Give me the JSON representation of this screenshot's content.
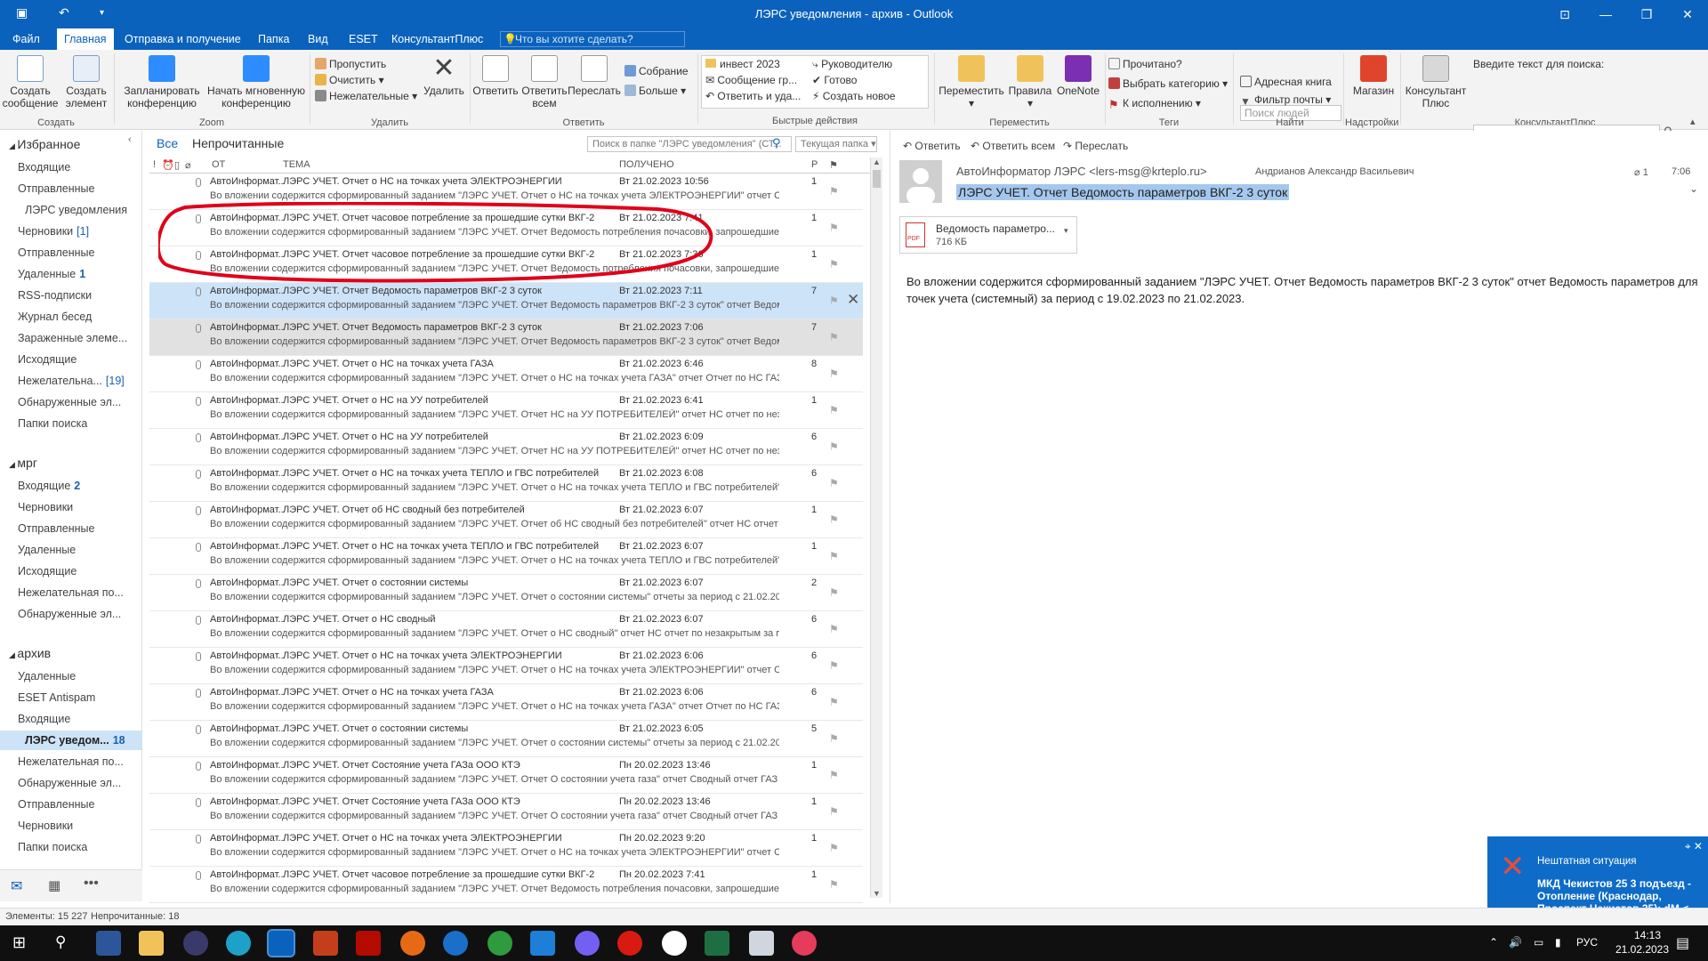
{
  "window": {
    "title": "ЛЭРС уведомления - архив - Outlook"
  },
  "menu": {
    "tabs": [
      "Файл",
      "Главная",
      "Отправка и получение",
      "Папка",
      "Вид",
      "ESET",
      "КонсультантПлюс"
    ],
    "tellme": "Что вы хотите сделать?"
  },
  "ribbon": {
    "create": {
      "label": "Создать",
      "new_mail": "Создать\nсообщение",
      "new_item": "Создать\nэлемент"
    },
    "zoom": {
      "label": "Zoom",
      "schedule": "Запланировать\nконференцию",
      "instant": "Начать мгновенную\nконференцию"
    },
    "delete": {
      "label": "Удалить",
      "ignore": "Пропустить",
      "clean": "Очистить",
      "junk": "Нежелательные",
      "delete_btn": "Удалить"
    },
    "respond": {
      "label": "Ответить",
      "reply": "Ответить",
      "reply_all": "Ответить\nвсем",
      "forward": "Переслать",
      "meeting": "Собрание",
      "more": "Больше"
    },
    "quick": {
      "label": "Быстрые действия",
      "items": [
        "инвест 2023",
        "Руководителю",
        "Сообщение гр...",
        "Готово",
        "Ответить и уда...",
        "Создать новое"
      ]
    },
    "move": {
      "label": "Переместить",
      "move_btn": "Переместить",
      "rules": "Правила",
      "onenote": "OneNote"
    },
    "tags": {
      "label": "Теги",
      "read": "Прочитано?",
      "category": "Выбрать категорию",
      "followup": "К исполнению"
    },
    "find": {
      "label": "Найти",
      "search_people": "Поиск людей",
      "address_book": "Адресная книга",
      "filter": "Фильтр почты"
    },
    "addins": {
      "label": "Надстройки",
      "store": "Магазин"
    },
    "consultant": {
      "label": "КонсультантПлюс",
      "btn": "Консультант\nПлюс",
      "prompt": "Введите текст для поиска:"
    }
  },
  "nav": [
    {
      "label": "Избранное",
      "type": "hdr"
    },
    {
      "label": "Входящие"
    },
    {
      "label": "Отправленные"
    },
    {
      "label": "ЛЭРС уведомления",
      "indent": true
    },
    {
      "label": "Черновики",
      "count": "[1]"
    },
    {
      "label": "Отправленные"
    },
    {
      "label": "Удаленные",
      "count": "1",
      "bold": true
    },
    {
      "label": "RSS-подписки"
    },
    {
      "label": "Журнал бесед"
    },
    {
      "label": "Зараженные элеме..."
    },
    {
      "label": "Исходящие"
    },
    {
      "label": "Нежелательна...",
      "count": "[19]"
    },
    {
      "label": "Обнаруженные эл..."
    },
    {
      "label": "Папки поиска"
    },
    {
      "label": "",
      "type": "gap"
    },
    {
      "label": "мрг",
      "type": "hdr"
    },
    {
      "label": "Входящие",
      "count": "2",
      "bold": true
    },
    {
      "label": "Черновики"
    },
    {
      "label": "Отправленные"
    },
    {
      "label": "Удаленные"
    },
    {
      "label": "Исходящие"
    },
    {
      "label": "Нежелательная по..."
    },
    {
      "label": "Обнаруженные эл..."
    },
    {
      "label": "",
      "type": "gap"
    },
    {
      "label": "архив",
      "type": "hdr"
    },
    {
      "label": "Удаленные"
    },
    {
      "label": "ESET Antispam"
    },
    {
      "label": "Входящие"
    },
    {
      "label": "ЛЭРС уведом...",
      "count": "18",
      "bold": true,
      "sel": true,
      "indent": true
    },
    {
      "label": "Нежелательная по..."
    },
    {
      "label": "Обнаруженные эл..."
    },
    {
      "label": "Отправленные"
    },
    {
      "label": "Черновики"
    },
    {
      "label": "Папки поиска"
    }
  ],
  "list": {
    "filter_all": "Все",
    "filter_unread": "Непрочитанные",
    "search_placeholder": "Поиск в папке \"ЛЭРС уведомления\" (СТ...",
    "current_folder": "Текущая папка",
    "col_from": "ОТ",
    "col_subject": "ТЕМА",
    "col_received": "ПОЛУЧЕНО",
    "col_size": "Р",
    "rows": [
      {
        "from": "АвтоИнформат...",
        "subject": "ЛЭРС УЧЕТ. Отчет о НС на точках учета ЭЛЕКТРОЭНЕРГИИ",
        "date": "Вт 21.02.2023 10:56",
        "size": "1",
        "preview": "Во вложении содержится сформированный заданием \"ЛЭРС УЧЕТ. Отчет о НС на точках учета ЭЛЕКТРОЭНЕРГИИ\" отчет Отчет по"
      },
      {
        "from": "АвтоИнформат...",
        "subject": "ЛЭРС УЧЕТ. Отчет часовое потребление за прошедшие сутки ВКГ-2",
        "date": "Вт 21.02.2023 7:41",
        "size": "1",
        "preview": "Во вложении содержится сформированный заданием \"ЛЭРС УЧЕТ. Отчет Ведомость потребления почасовки, запрошедшие сутки\""
      },
      {
        "from": "АвтоИнформат...",
        "subject": "ЛЭРС УЧЕТ. Отчет часовое потребление за прошедшие сутки ВКГ-2",
        "date": "Вт 21.02.2023 7:36",
        "size": "1",
        "preview": "Во вложении содержится сформированный заданием \"ЛЭРС УЧЕТ. Отчет Ведомость потребления почасовки, запрошедшие сутки\""
      },
      {
        "from": "АвтоИнформат...",
        "subject": "ЛЭРС УЧЕТ. Отчет Ведомость параметров ВКГ-2 3 суток",
        "date": "Вт 21.02.2023 7:11",
        "size": "7",
        "preview": "Во вложении содержится сформированный заданием \"ЛЭРС УЧЕТ. Отчет Ведомость параметров ВКГ-2 3 суток\" отчет Ведомость",
        "state": "sel"
      },
      {
        "from": "АвтоИнформат...",
        "subject": "ЛЭРС УЧЕТ. Отчет Ведомость параметров ВКГ-2 3 суток",
        "date": "Вт 21.02.2023 7:06",
        "size": "7",
        "preview": "Во вложении содержится сформированный заданием \"ЛЭРС УЧЕТ. Отчет Ведомость параметров ВКГ-2 3 суток\" отчет Ведомость",
        "state": "hl"
      },
      {
        "from": "АвтоИнформат...",
        "subject": "ЛЭРС УЧЕТ. Отчет о НС на точках учета ГАЗА",
        "date": "Вт 21.02.2023 6:46",
        "size": "8",
        "preview": "Во вложении содержится сформированный заданием \"ЛЭРС УЧЕТ. Отчет о НС на точках учета ГАЗА\" отчет Отчет по НС ГАЗ за"
      },
      {
        "from": "АвтоИнформат...",
        "subject": "ЛЭРС УЧЕТ. Отчет о НС на УУ потребителей",
        "date": "Вт 21.02.2023 6:41",
        "size": "1",
        "preview": "Во вложении содержится сформированный заданием \"ЛЭРС УЧЕТ. Отчет НС на УУ ПОТРЕБИТЕЛЕЙ\" отчет НС отчет по незакрытым"
      },
      {
        "from": "АвтоИнформат...",
        "subject": "ЛЭРС УЧЕТ. Отчет о НС на УУ потребителей",
        "date": "Вт 21.02.2023 6:09",
        "size": "6",
        "preview": "Во вложении содержится сформированный заданием \"ЛЭРС УЧЕТ. Отчет НС на УУ ПОТРЕБИТЕЛЕЙ\" отчет НС отчет по незакрытым"
      },
      {
        "from": "АвтоИнформат...",
        "subject": "ЛЭРС УЧЕТ. Отчет о  НС на точках учета ТЕПЛО и ГВС потребителей",
        "date": "Вт 21.02.2023 6:08",
        "size": "6",
        "preview": "Во вложении содержится сформированный заданием \"ЛЭРС УЧЕТ. Отчет о  НС на точках учета ТЕПЛО и ГВС потребителей\" отчет"
      },
      {
        "from": "АвтоИнформат...",
        "subject": "ЛЭРС УЧЕТ. Отчет об НС сводный без потребителей",
        "date": "Вт 21.02.2023 6:07",
        "size": "1",
        "preview": "Во вложении содержится сформированный заданием \"ЛЭРС УЧЕТ. Отчет об НС сводный без потребителей\" отчет НС отчет по"
      },
      {
        "from": "АвтоИнформат...",
        "subject": "ЛЭРС УЧЕТ. Отчет о  НС на точках учета ТЕПЛО и ГВС потребителей",
        "date": "Вт 21.02.2023 6:07",
        "size": "1",
        "preview": "Во вложении содержится сформированный заданием \"ЛЭРС УЧЕТ. Отчет о  НС на точках учета ТЕПЛО и ГВС потребителей\" отчет"
      },
      {
        "from": "АвтоИнформат...",
        "subject": "ЛЭРС УЧЕТ. Отчет о состоянии системы",
        "date": "Вт 21.02.2023 6:07",
        "size": "2",
        "preview": "Во вложении содержится сформированный заданием \"ЛЭРС УЧЕТ. Отчет о состоянии системы\" отчеты за период с 21.02.2023 по"
      },
      {
        "from": "АвтоИнформат...",
        "subject": "ЛЭРС УЧЕТ. Отчет о НС сводный",
        "date": "Вт 21.02.2023 6:07",
        "size": "6",
        "preview": "Во вложении содержится сформированный заданием \"ЛЭРС УЧЕТ. Отчет о НС сводный\" отчет НС отчет по незакрытым за период с"
      },
      {
        "from": "АвтоИнформат...",
        "subject": "ЛЭРС УЧЕТ. Отчет о НС на точках учета ЭЛЕКТРОЭНЕРГИИ",
        "date": "Вт 21.02.2023 6:06",
        "size": "6",
        "preview": "Во вложении содержится сформированный заданием \"ЛЭРС УЧЕТ. Отчет о НС на точках учета ЭЛЕКТРОЭНЕРГИИ\" отчет Отчет по"
      },
      {
        "from": "АвтоИнформат...",
        "subject": "ЛЭРС УЧЕТ. Отчет о НС на точках учета ГАЗА",
        "date": "Вт 21.02.2023 6:06",
        "size": "6",
        "preview": "Во вложении содержится сформированный заданием \"ЛЭРС УЧЕТ. Отчет о НС на точках учета ГАЗА\" отчет Отчет по НС ГАЗ за"
      },
      {
        "from": "АвтоИнформат...",
        "subject": "ЛЭРС УЧЕТ. Отчет о состоянии системы",
        "date": "Вт 21.02.2023 6:05",
        "size": "5",
        "preview": "Во вложении содержится сформированный заданием \"ЛЭРС УЧЕТ. Отчет о состоянии системы\" отчеты за период с 21.02.2023 по"
      },
      {
        "from": "АвтоИнформат...",
        "subject": "ЛЭРС УЧЕТ. Отчет Состояние учета ГАЗа ООО КТЭ",
        "date": "Пн 20.02.2023 13:46",
        "size": "1",
        "preview": "Во вложении содержится сформированный заданием \"ЛЭРС УЧЕТ. Отчет О состоянии учета газа\" отчет Сводный отчет ГАЗ за"
      },
      {
        "from": "АвтоИнформат...",
        "subject": "ЛЭРС УЧЕТ. Отчет Состояние учета ГАЗа ООО КТЭ",
        "date": "Пн 20.02.2023 13:46",
        "size": "1",
        "preview": "Во вложении содержится сформированный заданием \"ЛЭРС УЧЕТ. Отчет О состоянии учета газа\" отчет Сводный отчет ГАЗ за"
      },
      {
        "from": "АвтоИнформат...",
        "subject": "ЛЭРС УЧЕТ. Отчет о НС на точках учета ЭЛЕКТРОЭНЕРГИИ",
        "date": "Пн 20.02.2023 9:20",
        "size": "1",
        "preview": "Во вложении содержится сформированный заданием \"ЛЭРС УЧЕТ. Отчет о НС на точках учета ЭЛЕКТРОЭНЕРГИИ\" отчет Отчет по"
      },
      {
        "from": "АвтоИнформат...",
        "subject": "ЛЭРС УЧЕТ. Отчет часовое потребление за прошедшие сутки ВКГ-2",
        "date": "Пн 20.02.2023 7:41",
        "size": "1",
        "preview": "Во вложении содержится сформированный заданием \"ЛЭРС УЧЕТ. Отчет Ведомость потребления почасовки, запрошедшие сутки\""
      }
    ]
  },
  "reading": {
    "reply": "Ответить",
    "reply_all": "Ответить всем",
    "forward": "Переслать",
    "sender": "АвтоИнформатор ЛЭРС <lers-msg@krteplo.ru>",
    "to": "Андрианов Александр Васильевич",
    "count": "1",
    "time": "7:06",
    "subject": "ЛЭРС УЧЕТ. Отчет Ведомость параметров ВКГ-2 3 суток",
    "attachment_name": "Ведомость параметро...",
    "attachment_size": "716 КБ",
    "body": "Во вложении содержится сформированный заданием \"ЛЭРС УЧЕТ. Отчет Ведомость параметров ВКГ-2 3 суток\" отчет Ведомость параметров для точек учета (системный) за период с 19.02.2023 по 21.02.2023."
  },
  "toast": {
    "title": "Нештатная ситуация",
    "body": "МКД Чекистов 25 3  подъезд - Отопление (Краснодар, Проспект Чекистов 25): dM <"
  },
  "status": {
    "items": "Элементы: 15 227",
    "unread": "Непрочитанные: 18"
  },
  "taskbar": {
    "lang": "РУС",
    "time": "14:13",
    "date": "21.02.2023"
  },
  "colors": {
    "accent": "#0a62bd",
    "selection": "#cde3f7",
    "annotation": "#e0001a"
  }
}
